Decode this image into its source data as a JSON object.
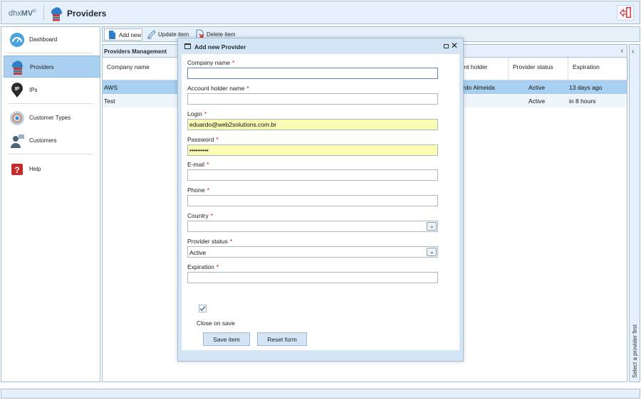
{
  "header": {
    "brand_prefix": "dhx",
    "brand_suffix": "MV",
    "brand_mark": "®",
    "title": "Providers",
    "title_icon": "providers-cloud-icon",
    "logout_icon": "logout-icon"
  },
  "sidebar": {
    "items": [
      {
        "label": "Dashboard",
        "icon": "dashboard-icon"
      },
      {
        "label": "Providers",
        "icon": "providers-cloud-icon",
        "active": true
      },
      {
        "label": "IPs",
        "icon": "ip-pin-icon"
      },
      {
        "label": "Customer Types",
        "icon": "customer-types-icon"
      },
      {
        "label": "Customers",
        "icon": "customers-icon"
      },
      {
        "label": "Help",
        "icon": "help-icon"
      }
    ]
  },
  "toolbar": {
    "add_label": "Add new",
    "update_label": "Update item",
    "delete_label": "Delete item"
  },
  "grid": {
    "caption": "Providers Management",
    "columns": [
      "Company name",
      "Account holder name",
      "Provider status",
      "Expiration"
    ],
    "visible_holder_header": "ount holder\ne",
    "rows": [
      {
        "company": "AWS",
        "holder": "rdo Almeida",
        "status": "Active",
        "expiration": "13 days ago",
        "selected": true
      },
      {
        "company": "Test",
        "holder": "",
        "status": "Active",
        "expiration": "in 8 hours",
        "selected": false
      }
    ]
  },
  "right_panel": {
    "vertical_text": "Select a provider first"
  },
  "modal": {
    "title": "Add new Provider",
    "fields": {
      "company_name": {
        "label": "Company name",
        "value": ""
      },
      "account_holder": {
        "label": "Account holder name",
        "value": ""
      },
      "login": {
        "label": "Login",
        "value": "eduardo@web2solutions.com.br"
      },
      "password": {
        "label": "Password",
        "value": "•••••••••"
      },
      "email": {
        "label": "E-mail",
        "value": ""
      },
      "phone": {
        "label": "Phone",
        "value": ""
      },
      "country": {
        "label": "Country",
        "value": ""
      },
      "provider_status": {
        "label": "Provider status",
        "value": "Active"
      },
      "expiration": {
        "label": "Expiration",
        "value": ""
      }
    },
    "required_mark": "*",
    "close_on_save_label": "Close on save",
    "close_on_save_checked": true,
    "save_label": "Save item",
    "reset_label": "Reset form"
  },
  "colors": {
    "panel_bg": "#e5f0fb",
    "border": "#a4bed4",
    "selected": "#a9d0f0",
    "autofill": "#fbfcb4",
    "required": "#d01010"
  }
}
